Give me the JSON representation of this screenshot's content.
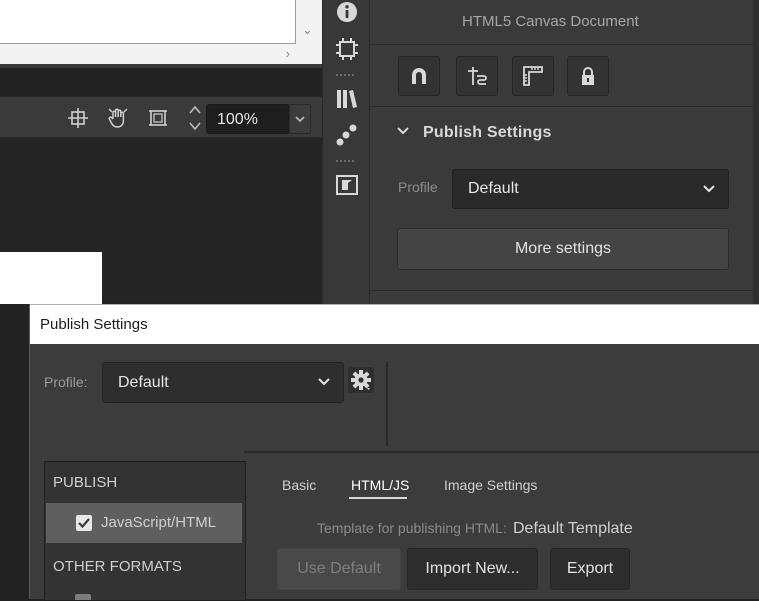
{
  "stage": {
    "zoom_value": "100%",
    "toolbar_icons": [
      "snap-to-center-icon",
      "hand-tool-icon",
      "clip-stage-icon"
    ]
  },
  "icon_strip": {
    "icons": [
      "info-icon",
      "align-icon",
      "library-icon",
      "motion-presets-icon",
      "components-icon"
    ]
  },
  "properties": {
    "document_type": "HTML5 Canvas Document",
    "snap_buttons": [
      "snap-magnet-icon",
      "snap-guides-icon",
      "ruler-icon",
      "lock-icon"
    ],
    "publish_settings": {
      "title": "Publish Settings",
      "profile_label": "Profile",
      "profile_value": "Default",
      "more_settings_label": "More settings"
    }
  },
  "dialog": {
    "title": "Publish Settings",
    "profile_label": "Profile:",
    "profile_value": "Default",
    "list": {
      "publish_header": "PUBLISH",
      "javascript_html_label": "JavaScript/HTML",
      "javascript_html_checked": true,
      "other_formats_header": "OTHER FORMATS"
    },
    "tabs": [
      {
        "label": "Basic",
        "active": false
      },
      {
        "label": "HTML/JS",
        "active": true
      },
      {
        "label": "Image Settings",
        "active": false
      }
    ],
    "template_label": "Template for publishing HTML:",
    "template_value": "Default Template",
    "buttons": {
      "use_default": "Use Default",
      "import_new": "Import New...",
      "export": "Export"
    }
  },
  "colors": {
    "panel_bg": "#3a3a3a",
    "stage_dark": "#252525",
    "selected_item": "#5f5f5f",
    "dialog_title_bg": "#ffffff"
  }
}
